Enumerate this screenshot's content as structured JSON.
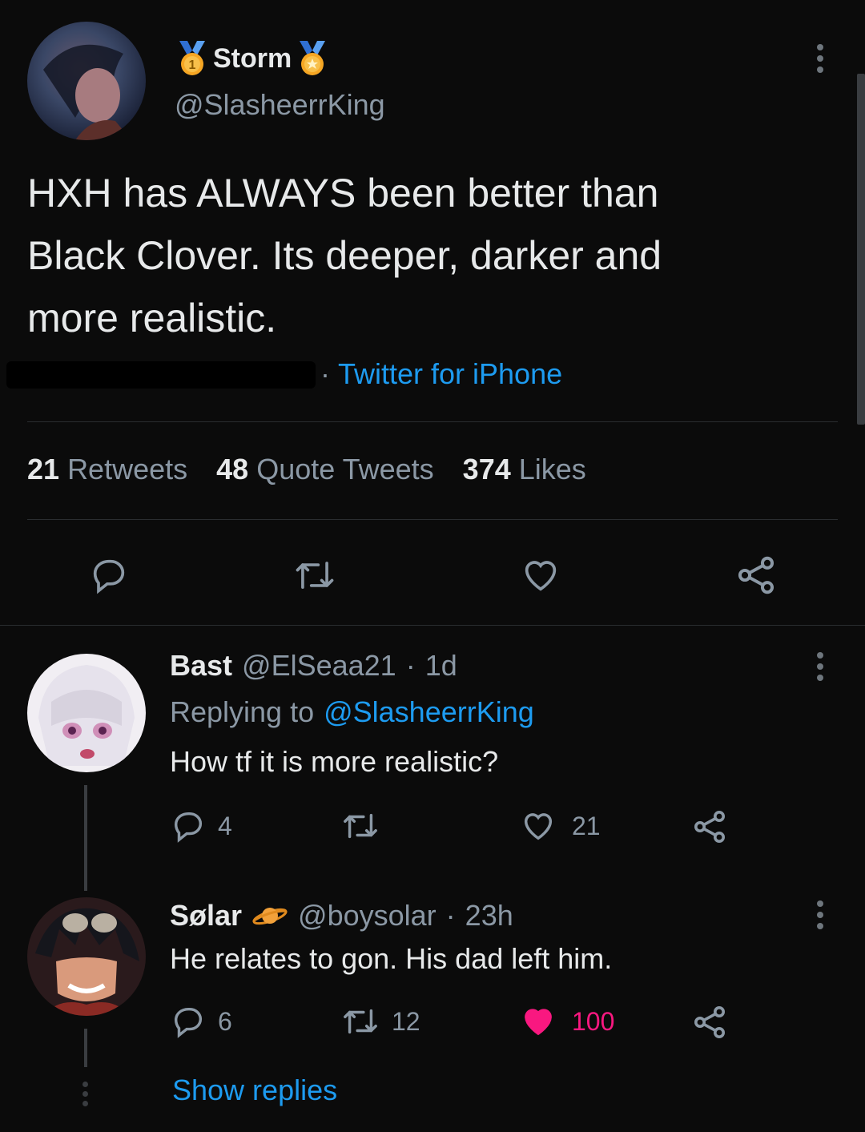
{
  "main_tweet": {
    "display_name": "Storm",
    "handle": "@SlasheerrKing",
    "text_lines": [
      "HXH has ALWAYS been better than",
      "Black Clover. Its deeper, darker and",
      "more realistic."
    ],
    "source_sep": "·",
    "source": "Twitter for iPhone",
    "stats": {
      "retweets": "21",
      "retweets_label": "Retweets",
      "quotes": "48",
      "quotes_label": "Quote Tweets",
      "likes": "374",
      "likes_label": "Likes"
    }
  },
  "replies": [
    {
      "display_name": "Bast",
      "handle": "@ElSeaa21",
      "dot": "·",
      "time": "1d",
      "replying_label": "Replying to",
      "replying_handle": "@SlasheerrKing",
      "text": "How tf it is more realistic?",
      "reply_count": "4",
      "retweet_count": "",
      "like_count": "21"
    },
    {
      "display_name": "Sølar",
      "handle": "@boysolar",
      "dot": "·",
      "time": "23h",
      "text": "He relates to gon. His dad left him.",
      "reply_count": "6",
      "retweet_count": "12",
      "like_count": "100",
      "liked": true
    }
  ],
  "show_replies": "Show replies",
  "colors": {
    "background": "#0b0b0b",
    "text": "#e7e9ea",
    "muted": "#8b98a5",
    "link": "#1d9bf0",
    "like_active": "#f91880",
    "medal": "#f5a623"
  }
}
